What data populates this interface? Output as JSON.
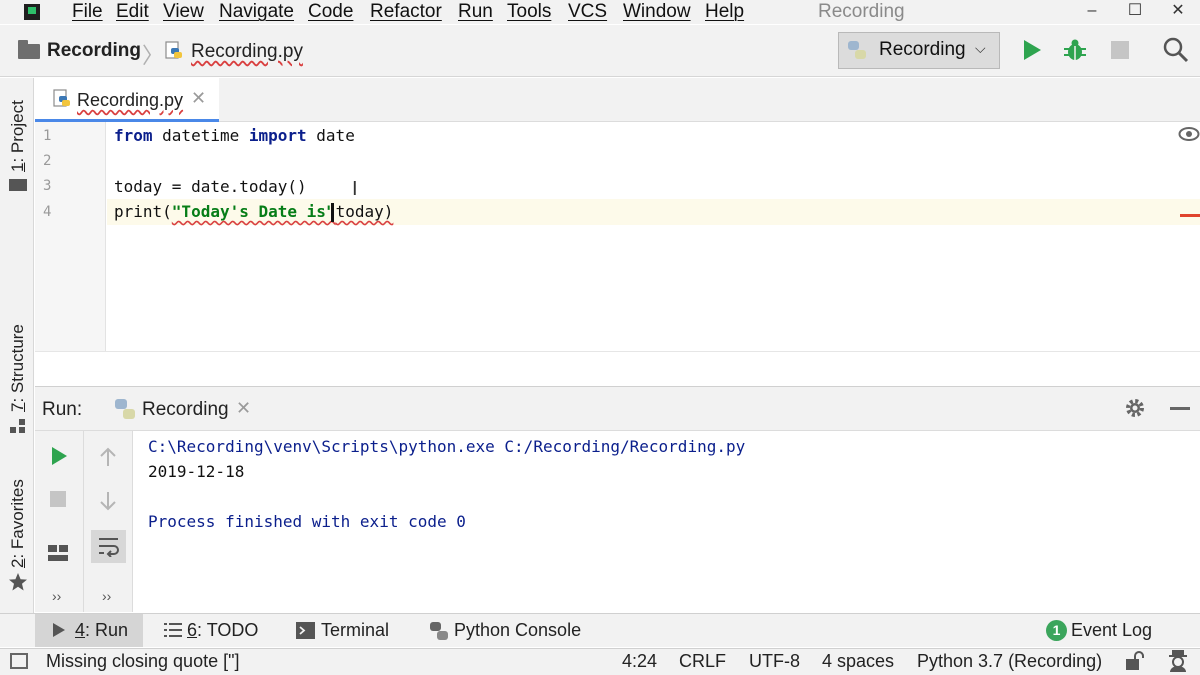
{
  "menu": [
    "File",
    "Edit",
    "View",
    "Navigate",
    "Code",
    "Refactor",
    "Run",
    "Tools",
    "VCS",
    "Window",
    "Help"
  ],
  "window": {
    "title": "Recording",
    "minimize": "–",
    "maximize": "☐",
    "close": "✕"
  },
  "breadcrumb": {
    "project": "Recording",
    "separator": "〉",
    "file": "Recording.py"
  },
  "run_config": {
    "label": "Recording",
    "chevron": "⌵"
  },
  "side_tabs": {
    "project_num": "1",
    "project": ": Project",
    "structure_num": "7",
    "structure": ": Structure",
    "favorites_num": "2",
    "favorites": ": Favorites"
  },
  "editor": {
    "tab_label": "Recording.py",
    "tab_close": "✕",
    "line_numbers": [
      "1",
      "2",
      "3",
      "4"
    ],
    "lines": {
      "l1_kw1": "from",
      "l1_mod": " datetime ",
      "l1_kw2": "import",
      "l1_name": " date",
      "l3": "today = date.today()",
      "l4_fn": "print(",
      "l4_str": "\"Today's Date is\"",
      "l4_rest": "today)"
    }
  },
  "run_panel": {
    "title": "Run:",
    "tab_label": "Recording",
    "tab_close": "✕",
    "more1": "››",
    "more2": "››",
    "console": [
      "C:\\Recording\\venv\\Scripts\\python.exe C:/Recording/Recording.py",
      "2019-12-18",
      "",
      "Process finished with exit code 0"
    ]
  },
  "tool_windows": {
    "run_num": "4",
    "run_label": ": Run",
    "todo_num": "6",
    "todo_label": ": TODO",
    "terminal": "Terminal",
    "python_console": "Python Console",
    "event_log_count": "1",
    "event_log": "Event Log"
  },
  "status": {
    "message": "Missing closing quote [\"]",
    "position": "4:24",
    "line_ending": "CRLF",
    "encoding": "UTF-8",
    "indent": "4 spaces",
    "interpreter": "Python 3.7 (Recording)"
  },
  "colors": {
    "keyword": "#0b1f8c",
    "string": "#067d17",
    "console_text": "#0b1f8c",
    "run_green": "#2ea44f",
    "accent_blue": "#4a88e8",
    "error_red": "#d94040"
  }
}
